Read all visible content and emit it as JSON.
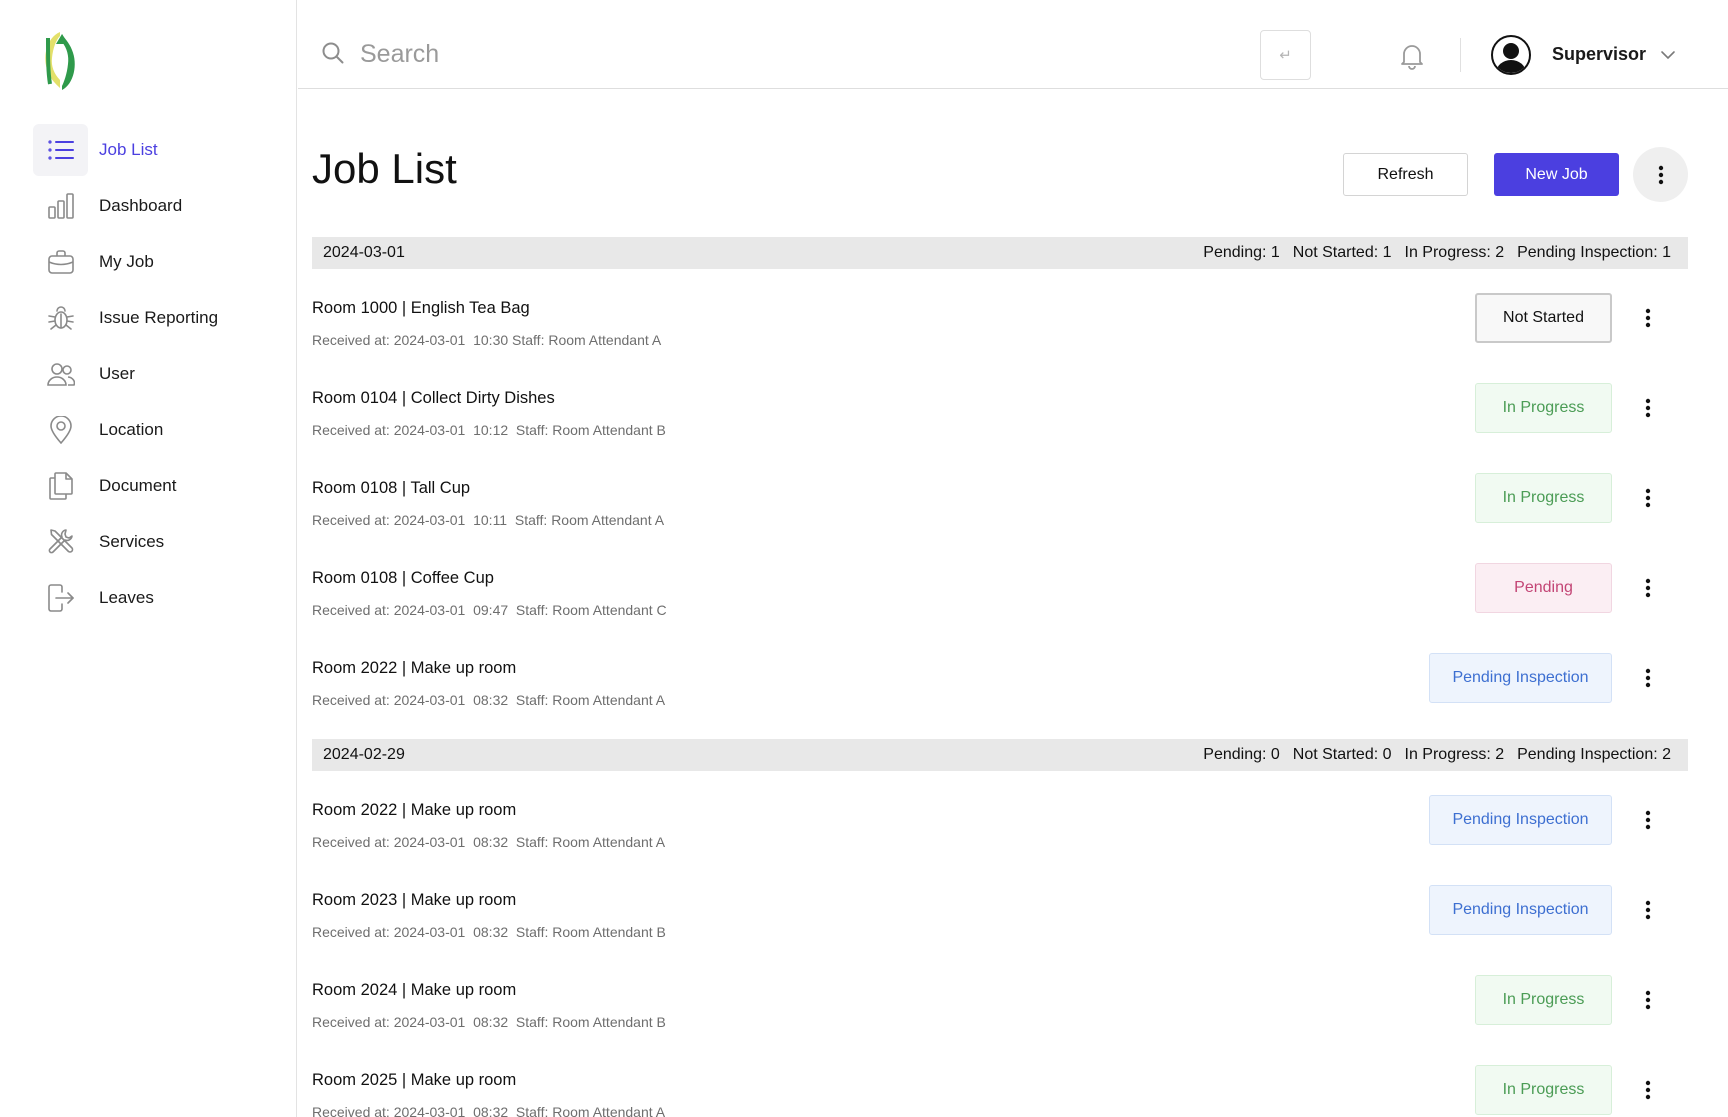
{
  "sidebar": {
    "items": [
      {
        "label": "Job List",
        "icon": "list-icon",
        "active": true
      },
      {
        "label": "Dashboard",
        "icon": "bar-chart-icon"
      },
      {
        "label": "My Job",
        "icon": "briefcase-icon"
      },
      {
        "label": "Issue Reporting",
        "icon": "bug-icon"
      },
      {
        "label": "User",
        "icon": "users-icon"
      },
      {
        "label": "Location",
        "icon": "map-pin-icon"
      },
      {
        "label": "Document",
        "icon": "documents-icon"
      },
      {
        "label": "Services",
        "icon": "tools-icon"
      },
      {
        "label": "Leaves",
        "icon": "logout-icon"
      }
    ]
  },
  "header": {
    "search_placeholder": "Search",
    "enter_glyph": "↵",
    "user_name": "Supervisor"
  },
  "main": {
    "title": "Job List",
    "refresh_label": "Refresh",
    "new_job_label": "New Job"
  },
  "colors": {
    "accent": "#4b3fe0",
    "in_progress": "#4b9c55",
    "pending": "#c34575",
    "pending_inspection": "#3d6fd1"
  },
  "groups": [
    {
      "date": "2024-03-01",
      "stats": [
        "Pending: 1",
        "Not Started: 1",
        "In Progress: 2",
        "Pending Inspection: 1"
      ],
      "jobs": [
        {
          "title": "Room 1000 | English Tea Bag",
          "meta": "Received at: 2024-03-01  10:30 Staff: Room Attendant A",
          "status": "Not Started",
          "status_class": "not-started"
        },
        {
          "title": "Room 0104 | Collect Dirty Dishes",
          "meta": "Received at: 2024-03-01  10:12  Staff: Room Attendant B",
          "status": "In Progress",
          "status_class": "in-progress"
        },
        {
          "title": "Room 0108 | Tall Cup",
          "meta": "Received at: 2024-03-01  10:11  Staff: Room Attendant A",
          "status": "In Progress",
          "status_class": "in-progress"
        },
        {
          "title": "Room 0108 | Coffee Cup",
          "meta": "Received at: 2024-03-01  09:47  Staff: Room Attendant C",
          "status": "Pending",
          "status_class": "pending"
        },
        {
          "title": "Room 2022 | Make up room",
          "meta": "Received at: 2024-03-01  08:32  Staff: Room Attendant A",
          "status": "Pending Inspection",
          "status_class": "pending-inspection"
        }
      ]
    },
    {
      "date": "2024-02-29",
      "stats": [
        "Pending: 0",
        "Not Started: 0",
        "In Progress: 2",
        "Pending Inspection: 2"
      ],
      "jobs": [
        {
          "title": "Room 2022 | Make up room",
          "meta": "Received at: 2024-03-01  08:32  Staff: Room Attendant A",
          "status": "Pending Inspection",
          "status_class": "pending-inspection"
        },
        {
          "title": "Room 2023 | Make up room",
          "meta": "Received at: 2024-03-01  08:32  Staff: Room Attendant B",
          "status": "Pending Inspection",
          "status_class": "pending-inspection"
        },
        {
          "title": "Room 2024 | Make up room",
          "meta": "Received at: 2024-03-01  08:32  Staff: Room Attendant B",
          "status": "In Progress",
          "status_class": "in-progress"
        },
        {
          "title": "Room 2025 | Make up room",
          "meta": "Received at: 2024-03-01  08:32  Staff: Room Attendant A",
          "status": "In Progress",
          "status_class": "in-progress"
        }
      ]
    }
  ]
}
